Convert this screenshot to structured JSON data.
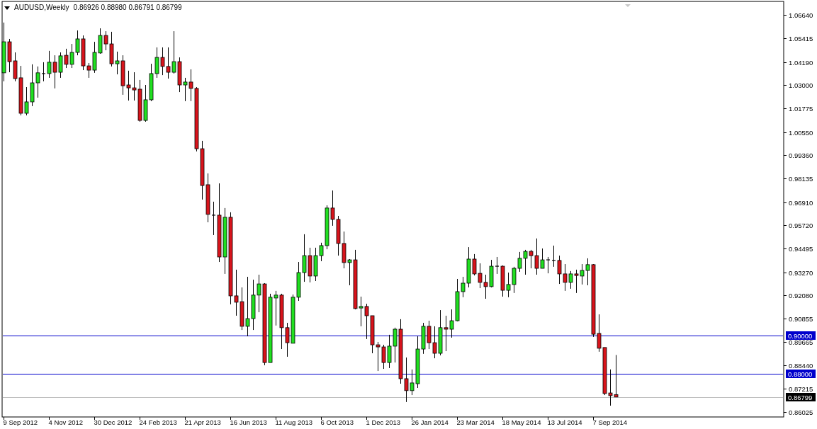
{
  "header": {
    "symbol": "AUDUSD,Weekly",
    "quote": "0.86926 0.88980 0.86791 0.86799"
  },
  "price_axis": [
    "1.06640",
    "1.05415",
    "1.04190",
    "1.03000",
    "1.01775",
    "1.00550",
    "0.99360",
    "0.98135",
    "0.96910",
    "0.95720",
    "0.94495",
    "0.93270",
    "0.92080",
    "0.90855",
    "0.89665",
    "0.88440",
    "0.87215",
    "0.86025"
  ],
  "time_axis": [
    "9 Sep 2012",
    "4 Nov 2012",
    "30 Dec 2012",
    "24 Feb 2013",
    "21 Apr 2013",
    "16 Jun 2013",
    "11 Aug 2013",
    "6 Oct 2013",
    "1 Dec 2013",
    "26 Jan 2014",
    "23 Mar 2014",
    "18 May 2014",
    "13 Jul 2014",
    "7 Sep 2014"
  ],
  "price_lines": [
    {
      "kind": "level",
      "label": "0.90000"
    },
    {
      "kind": "level",
      "label": "0.88000"
    },
    {
      "kind": "current",
      "label": "0.86799"
    }
  ]
}
